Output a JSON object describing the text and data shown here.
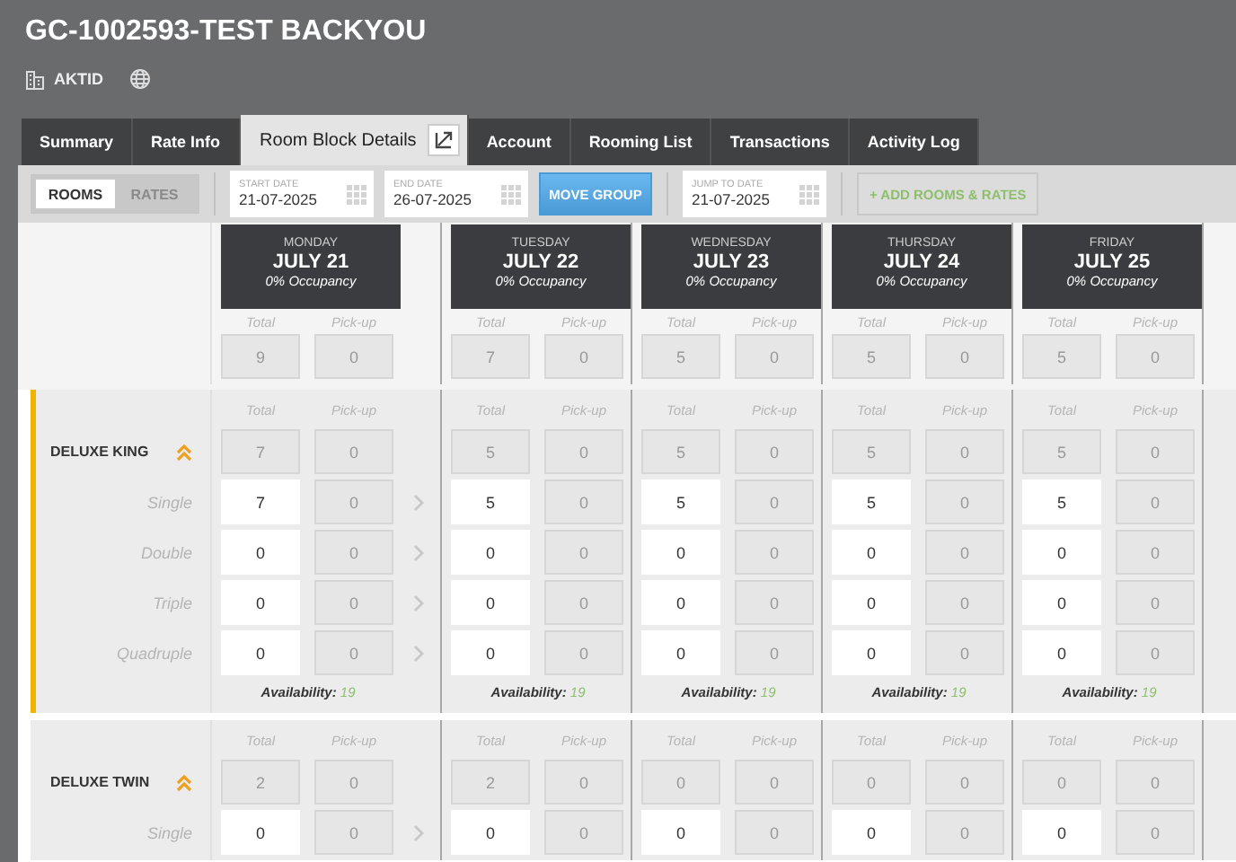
{
  "header": {
    "title": "GC-1002593-TEST BACKYOU",
    "property": "AKTID"
  },
  "tabs": [
    {
      "label": "Summary",
      "selected": false,
      "popout": false
    },
    {
      "label": "Rate Info",
      "selected": false,
      "popout": false
    },
    {
      "label": "Room Block Details",
      "selected": true,
      "popout": true
    },
    {
      "label": "Account",
      "selected": false,
      "popout": false
    },
    {
      "label": "Rooming List",
      "selected": false,
      "popout": false
    },
    {
      "label": "Transactions",
      "selected": false,
      "popout": false
    },
    {
      "label": "Activity Log",
      "selected": false,
      "popout": false
    }
  ],
  "toolbar": {
    "view_toggle": [
      {
        "label": "ROOMS",
        "selected": true
      },
      {
        "label": "RATES",
        "selected": false
      }
    ],
    "start_date": {
      "label": "START DATE",
      "value": "21-07-2025"
    },
    "end_date": {
      "label": "END DATE",
      "value": "26-07-2025"
    },
    "move_group": "MOVE GROUP",
    "jump_to_date": {
      "label": "JUMP TO DATE",
      "value": "21-07-2025"
    },
    "add_rooms": "+ ADD ROOMS & RATES"
  },
  "days": [
    {
      "weekday": "MONDAY",
      "date": "JULY 21",
      "occupancy": "0% Occupancy",
      "labels": [
        "Total",
        "Pick-up"
      ],
      "total": "9",
      "pickup": "0"
    },
    {
      "weekday": "TUESDAY",
      "date": "JULY 22",
      "occupancy": "0% Occupancy",
      "labels": [
        "Total",
        "Pick-up"
      ],
      "total": "7",
      "pickup": "0"
    },
    {
      "weekday": "WEDNESDAY",
      "date": "JULY 23",
      "occupancy": "0% Occupancy",
      "labels": [
        "Total",
        "Pick-up"
      ],
      "total": "5",
      "pickup": "0"
    },
    {
      "weekday": "THURSDAY",
      "date": "JULY 24",
      "occupancy": "0% Occupancy",
      "labels": [
        "Total",
        "Pick-up"
      ],
      "total": "5",
      "pickup": "0"
    },
    {
      "weekday": "FRIDAY",
      "date": "JULY 25",
      "occupancy": "0% Occupancy",
      "labels": [
        "Total",
        "Pick-up"
      ],
      "total": "5",
      "pickup": "0"
    }
  ],
  "room_types": [
    {
      "name": "DELUXE KING",
      "active": true,
      "rates": [
        "Single",
        "Double",
        "Triple",
        "Quadruple"
      ],
      "columns": [
        {
          "labels": [
            "Total",
            "Pick-up"
          ],
          "total": "7",
          "pickup": "0",
          "rows": [
            [
              "7",
              "0"
            ],
            [
              "0",
              "0"
            ],
            [
              "0",
              "0"
            ],
            [
              "0",
              "0"
            ]
          ],
          "availability_label": "Availability:",
          "availability": "19"
        },
        {
          "labels": [
            "Total",
            "Pick-up"
          ],
          "total": "5",
          "pickup": "0",
          "rows": [
            [
              "5",
              "0"
            ],
            [
              "0",
              "0"
            ],
            [
              "0",
              "0"
            ],
            [
              "0",
              "0"
            ]
          ],
          "availability_label": "Availability:",
          "availability": "19"
        },
        {
          "labels": [
            "Total",
            "Pick-up"
          ],
          "total": "5",
          "pickup": "0",
          "rows": [
            [
              "5",
              "0"
            ],
            [
              "0",
              "0"
            ],
            [
              "0",
              "0"
            ],
            [
              "0",
              "0"
            ]
          ],
          "availability_label": "Availability:",
          "availability": "19"
        },
        {
          "labels": [
            "Total",
            "Pick-up"
          ],
          "total": "5",
          "pickup": "0",
          "rows": [
            [
              "5",
              "0"
            ],
            [
              "0",
              "0"
            ],
            [
              "0",
              "0"
            ],
            [
              "0",
              "0"
            ]
          ],
          "availability_label": "Availability:",
          "availability": "19"
        },
        {
          "labels": [
            "Total",
            "Pick-up"
          ],
          "total": "5",
          "pickup": "0",
          "rows": [
            [
              "5",
              "0"
            ],
            [
              "0",
              "0"
            ],
            [
              "0",
              "0"
            ],
            [
              "0",
              "0"
            ]
          ],
          "availability_label": "Availability:",
          "availability": "19"
        }
      ]
    },
    {
      "name": "DELUXE TWIN",
      "active": false,
      "rates": [
        "Single"
      ],
      "columns": [
        {
          "labels": [
            "Total",
            "Pick-up"
          ],
          "total": "2",
          "pickup": "0",
          "rows": [
            [
              "0",
              "0"
            ]
          ]
        },
        {
          "labels": [
            "Total",
            "Pick-up"
          ],
          "total": "2",
          "pickup": "0",
          "rows": [
            [
              "0",
              "0"
            ]
          ]
        },
        {
          "labels": [
            "Total",
            "Pick-up"
          ],
          "total": "0",
          "pickup": "0",
          "rows": [
            [
              "0",
              "0"
            ]
          ]
        },
        {
          "labels": [
            "Total",
            "Pick-up"
          ],
          "total": "0",
          "pickup": "0",
          "rows": [
            [
              "0",
              "0"
            ]
          ]
        },
        {
          "labels": [
            "Total",
            "Pick-up"
          ],
          "total": "0",
          "pickup": "0",
          "rows": [
            [
              "0",
              "0"
            ]
          ]
        }
      ]
    }
  ]
}
